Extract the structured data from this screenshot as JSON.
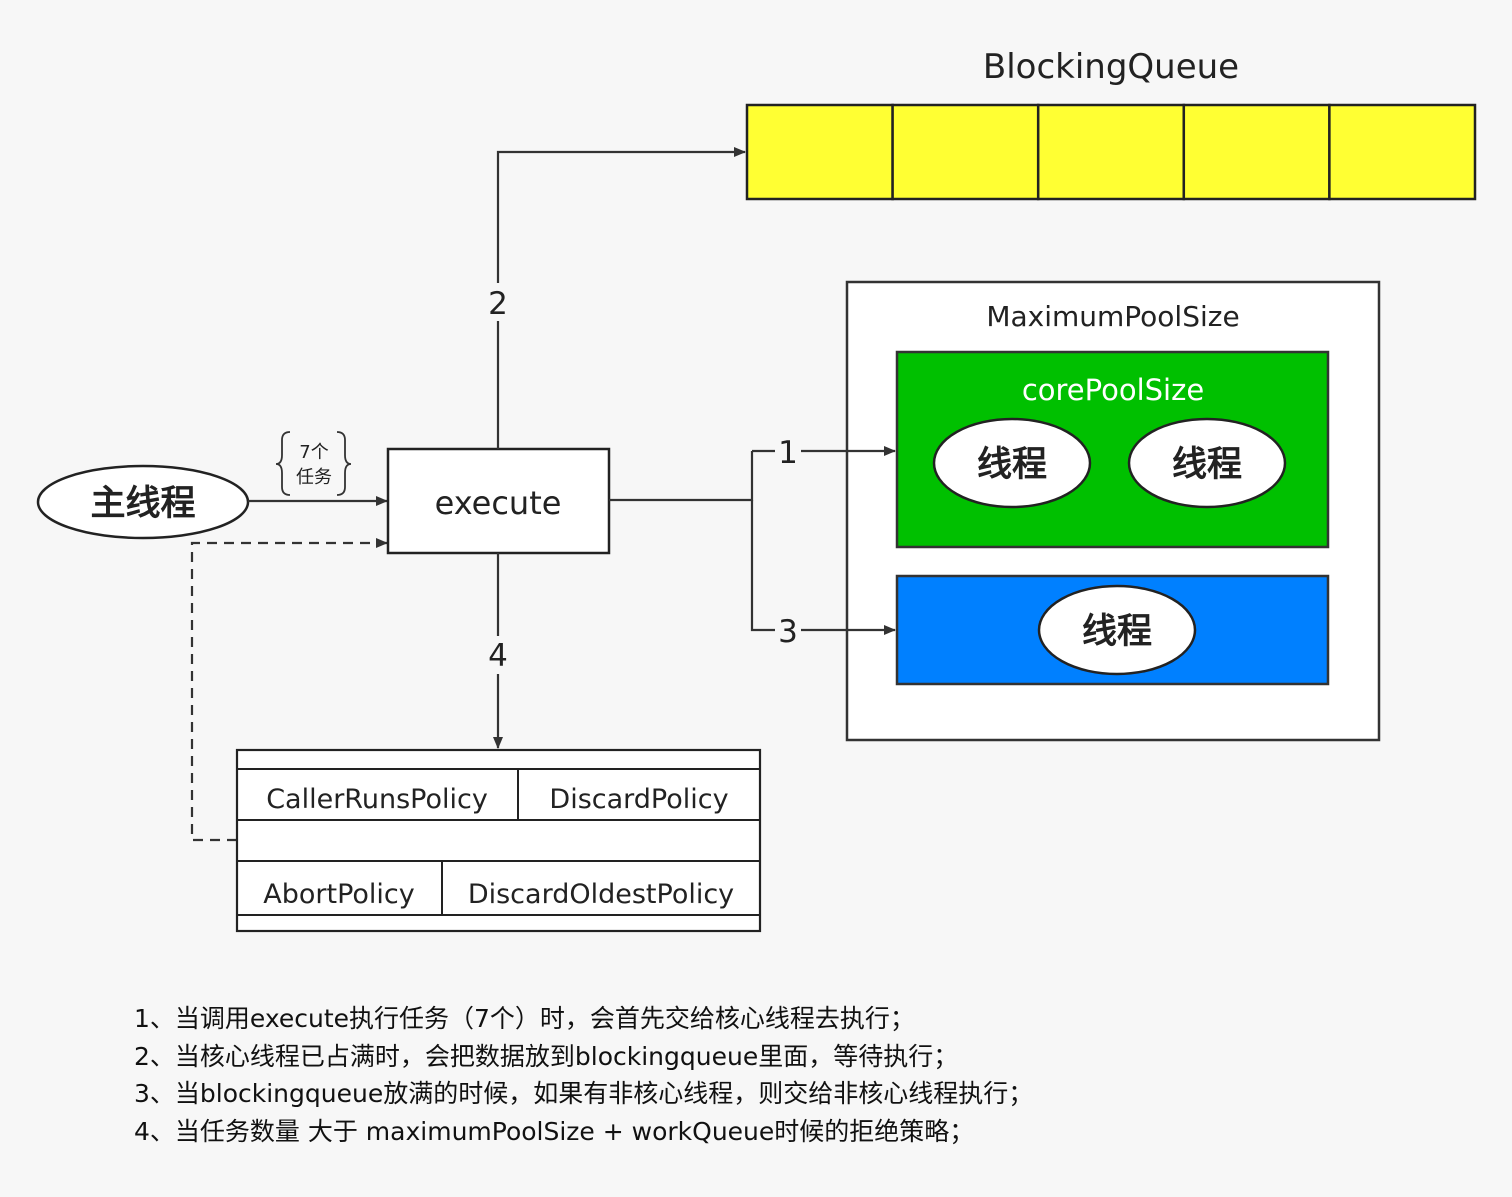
{
  "main_thread": {
    "label": "主线程"
  },
  "task_brace": {
    "line1": "7个",
    "line2": "任务"
  },
  "execute": {
    "label": "execute"
  },
  "blocking_queue": {
    "title": "BlockingQueue",
    "slot_count": 5,
    "color": "#ffff33"
  },
  "max_pool": {
    "title": "MaximumPoolSize"
  },
  "core_pool": {
    "title": "corePoolSize",
    "color": "#00c000",
    "threads": [
      "线程",
      "线程"
    ]
  },
  "non_core_pool": {
    "color": "#0080ff",
    "threads": [
      "线程"
    ]
  },
  "paths": {
    "p1": "1",
    "p2": "2",
    "p3": "3",
    "p4": "4"
  },
  "policies": {
    "row1": [
      "CallerRunsPolicy",
      "DiscardPolicy"
    ],
    "row2": [
      "AbortPolicy",
      "DiscardOldestPolicy"
    ]
  },
  "notes": [
    "1、当调用execute执行任务（7个）时，会首先交给核心线程去执行；",
    "2、当核心线程已占满时，会把数据放到blockingqueue里面，等待执行；",
    "3、当blockingqueue放满的时候，如果有非核心线程，则交给非核心线程执行；",
    "4、当任务数量 大于 maximumPoolSize + workQueue时候的拒绝策略；"
  ]
}
